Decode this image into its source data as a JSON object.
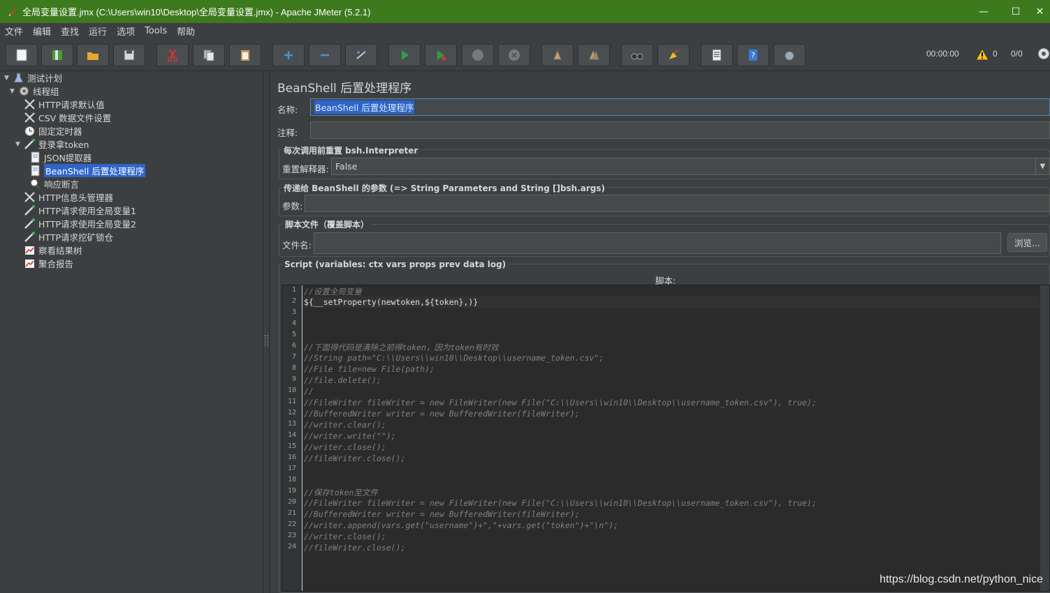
{
  "window": {
    "title": "全局变量设置.jmx (C:\\Users\\win10\\Desktop\\全局变量设置.jmx) - Apache JMeter (5.2.1)",
    "minimize": "—",
    "maximize": "☐",
    "close": "✕"
  },
  "menu": [
    "文件",
    "编辑",
    "查找",
    "运行",
    "选项",
    "Tools",
    "帮助"
  ],
  "toolbar": {
    "timer": "00:00:00",
    "warnings": "0",
    "threads": "0/0"
  },
  "tree": [
    {
      "label": "测试计划",
      "icon": "test-plan-icon",
      "level": 0,
      "expanded": true
    },
    {
      "label": "线程组",
      "icon": "thread-group-icon",
      "level": 1,
      "expanded": true
    },
    {
      "label": "HTTP请求默认值",
      "icon": "config-element-icon",
      "level": 2
    },
    {
      "label": "CSV 数据文件设置",
      "icon": "config-element-icon",
      "level": 2
    },
    {
      "label": "固定定时器",
      "icon": "timer-icon",
      "level": 2
    },
    {
      "label": "登录拿token",
      "icon": "sampler-icon",
      "level": 2,
      "expanded": true
    },
    {
      "label": "JSON提取器",
      "icon": "post-processor-icon",
      "level": 3
    },
    {
      "label": "BeanShell 后置处理程序",
      "icon": "post-processor-icon",
      "level": 3,
      "selected": true
    },
    {
      "label": "响应断言",
      "icon": "assertion-icon",
      "level": 3
    },
    {
      "label": "HTTP信息头管理器",
      "icon": "config-element-icon",
      "level": 2
    },
    {
      "label": "HTTP请求使用全局变量1",
      "icon": "sampler-icon",
      "level": 2
    },
    {
      "label": "HTTP请求使用全局变量2",
      "icon": "sampler-icon",
      "level": 2
    },
    {
      "label": "HTTP请求挖矿锁仓",
      "icon": "sampler-icon",
      "level": 2
    },
    {
      "label": "察看结果树",
      "icon": "listener-icon",
      "level": 2
    },
    {
      "label": "聚合报告",
      "icon": "listener-icon",
      "level": 2
    }
  ],
  "panel": {
    "title": "BeanShell 后置处理程序",
    "name_label": "名称:",
    "name_value": "BeanShell 后置处理程序",
    "comment_label": "注释:",
    "comment_value": "",
    "reset_group_title": "每次调用前重置 bsh.Interpreter",
    "reset_label": "重置解释器:",
    "reset_value": "False",
    "params_group_title": "传递给 BeanShell 的参数 (=> String Parameters and String []bsh.args)",
    "params_label": "参数:",
    "params_value": "",
    "file_group_title": "脚本文件（覆盖脚本）",
    "file_label": "文件名:",
    "file_value": "",
    "browse_label": "浏览...",
    "script_group_title": "Script (variables: ctx vars props prev data log)",
    "script_label": "脚本:"
  },
  "script_lines": [
    {
      "text": "//设置全局变量",
      "comment": true
    },
    {
      "text": "${__setProperty(newtoken,${token},)}",
      "comment": false
    },
    {
      "text": "",
      "comment": false
    },
    {
      "text": "",
      "comment": false
    },
    {
      "text": "",
      "comment": false
    },
    {
      "text": "//下面得代码是清除之前得token，因为token有时效",
      "comment": true
    },
    {
      "text": "//String path=\"C:\\\\Users\\\\win10\\\\Desktop\\\\username_token.csv\";",
      "comment": true
    },
    {
      "text": "//File file=new File(path);",
      "comment": true
    },
    {
      "text": "//file.delete();",
      "comment": true
    },
    {
      "text": "//",
      "comment": true
    },
    {
      "text": "//FileWriter fileWriter = new FileWriter(new File(\"C:\\\\Users\\\\win10\\\\Desktop\\\\username_token.csv\"), true);",
      "comment": true
    },
    {
      "text": "//BufferedWriter writer = new BufferedWriter(fileWriter);",
      "comment": true
    },
    {
      "text": "//writer.clear();",
      "comment": true
    },
    {
      "text": "//writer.write(\"\");",
      "comment": true
    },
    {
      "text": "//writer.close();",
      "comment": true
    },
    {
      "text": "//fileWriter.close();",
      "comment": true
    },
    {
      "text": "",
      "comment": false
    },
    {
      "text": "",
      "comment": false
    },
    {
      "text": "//保存token至文件",
      "comment": true
    },
    {
      "text": "//FileWriter fileWriter = new FileWriter(new File(\"C:\\\\Users\\\\win10\\\\Desktop\\\\username_token.csv\"), true);",
      "comment": true
    },
    {
      "text": "//BufferedWriter writer = new BufferedWriter(fileWriter);",
      "comment": true
    },
    {
      "text": "//writer.append(vars.get(\"username\")+\",\"+vars.get(\"token\")+\"\\n\");",
      "comment": true
    },
    {
      "text": "//writer.close();",
      "comment": true
    },
    {
      "text": "//fileWriter.close();",
      "comment": true
    }
  ],
  "watermark": "https://blog.csdn.net/python_nice",
  "colors": {
    "titlebar": "#3d7a1e",
    "background": "#3c3f41",
    "selection": "#2f65ca",
    "editor": "#2b2b2b"
  }
}
